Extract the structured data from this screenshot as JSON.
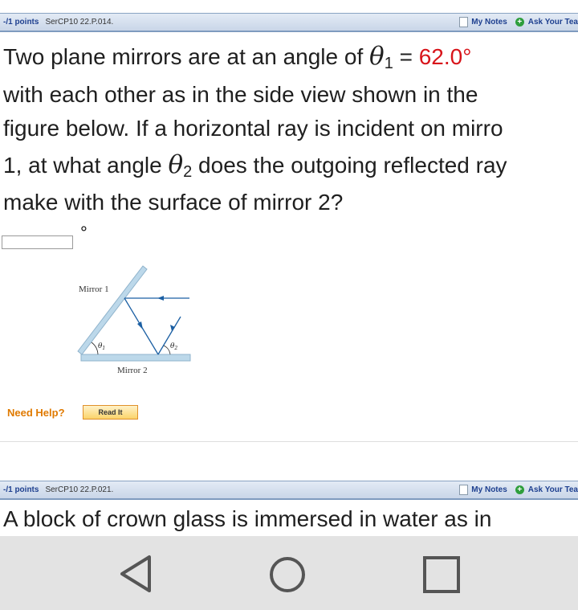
{
  "question1": {
    "header": {
      "points": "-/1 points",
      "code": "SerCP10 22.P.014.",
      "my_notes": "My Notes",
      "ask_teacher": "Ask Your Tea"
    },
    "text": {
      "line1_a": "Two plane mirrors are at an angle of ",
      "theta1_symbol": "θ",
      "theta1_sub": "1",
      "line1_eq": " = ",
      "line1_value": "62.0°",
      "line2": "with each other as in the side view shown in the",
      "line3": "figure below. If a horizontal ray is incident on mirro",
      "line4_a": "1, at what angle ",
      "theta2_symbol": "θ",
      "theta2_sub": "2",
      "line4_b": " does the outgoing reflected ray",
      "line5": "make with the surface of mirror 2?"
    },
    "answer": {
      "value": "",
      "unit": "°"
    },
    "figure": {
      "mirror1_label": "Mirror 1",
      "mirror2_label": "Mirror 2",
      "theta1_label": "θ",
      "theta1_label_sub": "1",
      "theta2_label": "θ",
      "theta2_label_sub": "2"
    },
    "help": {
      "label": "Need Help?",
      "read_it": "Read It"
    }
  },
  "question2": {
    "header": {
      "points": "-/1 points",
      "code": "SerCP10 22.P.021.",
      "my_notes": "My Notes",
      "ask_teacher": "Ask Your Tea"
    },
    "text": {
      "line1": "A block of crown glass is immersed in water as in"
    }
  },
  "navigation": {
    "back_icon": "back-triangle-icon",
    "home_icon": "home-circle-icon",
    "recents_icon": "recents-square-icon"
  },
  "colors": {
    "header_text": "#1d3f8f",
    "red_value": "#d8141a",
    "help_orange": "#e07a00",
    "mirror_blue": "#bcd8ea",
    "ray_blue": "#1b5fa3"
  }
}
